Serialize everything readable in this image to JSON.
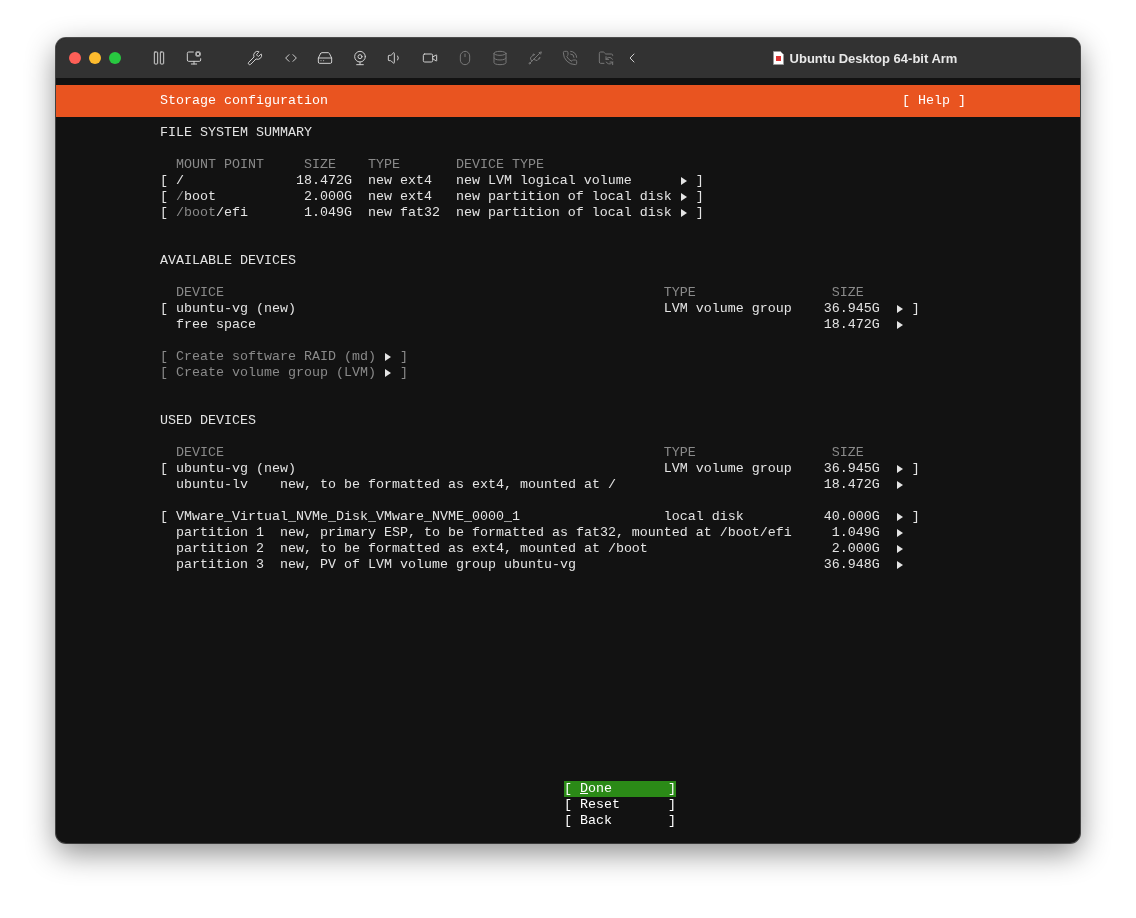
{
  "window": {
    "title": "Ubuntu Desktop 64-bit Arm"
  },
  "toolbar": [
    {
      "kind": "pause",
      "disabled": false
    },
    {
      "kind": "vm-settings",
      "disabled": false
    },
    {
      "kind": "wrench",
      "disabled": false
    },
    {
      "kind": "network",
      "disabled": false
    },
    {
      "kind": "disk",
      "disabled": false
    },
    {
      "kind": "webcam",
      "disabled": false
    },
    {
      "kind": "speaker",
      "disabled": false
    },
    {
      "kind": "camera",
      "disabled": false
    },
    {
      "kind": "mouse",
      "disabled": true
    },
    {
      "kind": "stack",
      "disabled": true
    },
    {
      "kind": "usb",
      "disabled": true
    },
    {
      "kind": "phone",
      "disabled": true
    },
    {
      "kind": "folder",
      "disabled": true
    },
    {
      "kind": "back",
      "disabled": false
    }
  ],
  "header": {
    "title": "Storage configuration",
    "help": "[ Help ]"
  },
  "filesystem_summary": {
    "title": "FILE SYSTEM SUMMARY",
    "columns": [
      "MOUNT POINT",
      "SIZE",
      "TYPE",
      "DEVICE TYPE"
    ],
    "rows": [
      {
        "left": "[",
        "mount_point": [
          {
            "text": "/",
            "dim": false
          }
        ],
        "size": "18.472G",
        "type": "new ext4",
        "device_type": "new LVM logical volume",
        "right": "]"
      },
      {
        "left": "[",
        "mount_point": [
          {
            "text": "/",
            "dim": true
          },
          {
            "text": "boot",
            "dim": false
          }
        ],
        "size": "2.000G",
        "type": "new ext4",
        "device_type": "new partition of local disk",
        "right": "]"
      },
      {
        "left": "[",
        "mount_point": [
          {
            "text": "/boot",
            "dim": true
          },
          {
            "text": "/efi",
            "dim": false
          }
        ],
        "size": "1.049G",
        "type": "new fat32",
        "device_type": "new partition of local disk",
        "right": "]"
      }
    ]
  },
  "available_devices": {
    "title": "AVAILABLE DEVICES",
    "columns": [
      "DEVICE",
      "TYPE",
      "SIZE"
    ],
    "devices": [
      {
        "left": "[",
        "name": "ubuntu-vg (new)",
        "type": "LVM volume group",
        "size": "36.945G",
        "right": "]",
        "children": [
          {
            "name": "free space",
            "size": "18.472G"
          }
        ]
      }
    ],
    "actions": [
      {
        "left": "[",
        "label": "Create software RAID (md)",
        "right": "]",
        "disabled": true
      },
      {
        "left": "[",
        "label": "Create volume group (LVM)",
        "right": "]",
        "disabled": true
      }
    ]
  },
  "used_devices": {
    "title": "USED DEVICES",
    "columns": [
      "DEVICE",
      "TYPE",
      "SIZE"
    ],
    "devices": [
      {
        "left": "[",
        "name": "ubuntu-vg (new)",
        "type": "LVM volume group",
        "size": "36.945G",
        "right": "]",
        "children": [
          {
            "name": "ubuntu-lv",
            "description": "new, to be formatted as ext4, mounted at /",
            "size": "18.472G"
          }
        ]
      },
      {
        "left": "[",
        "name": "VMware_Virtual_NVMe_Disk_VMware_NVME_0000_1",
        "type": "local disk",
        "size": "40.000G",
        "right": "]",
        "children": [
          {
            "name": "partition 1",
            "description": "new, primary ESP, to be formatted as fat32, mounted at /boot/efi",
            "size": "1.049G"
          },
          {
            "name": "partition 2",
            "description": "new, to be formatted as ext4, mounted at /boot",
            "size": "2.000G"
          },
          {
            "name": "partition 3",
            "description": "new, PV of LVM volume group ubuntu-vg",
            "size": "36.948G"
          }
        ]
      }
    ]
  },
  "buttons": [
    {
      "left": "[",
      "label": "Done",
      "right": "]",
      "selected": true
    },
    {
      "left": "[",
      "label": "Reset",
      "right": "]",
      "selected": false
    },
    {
      "left": "[",
      "label": "Back",
      "right": "]",
      "selected": false
    }
  ]
}
